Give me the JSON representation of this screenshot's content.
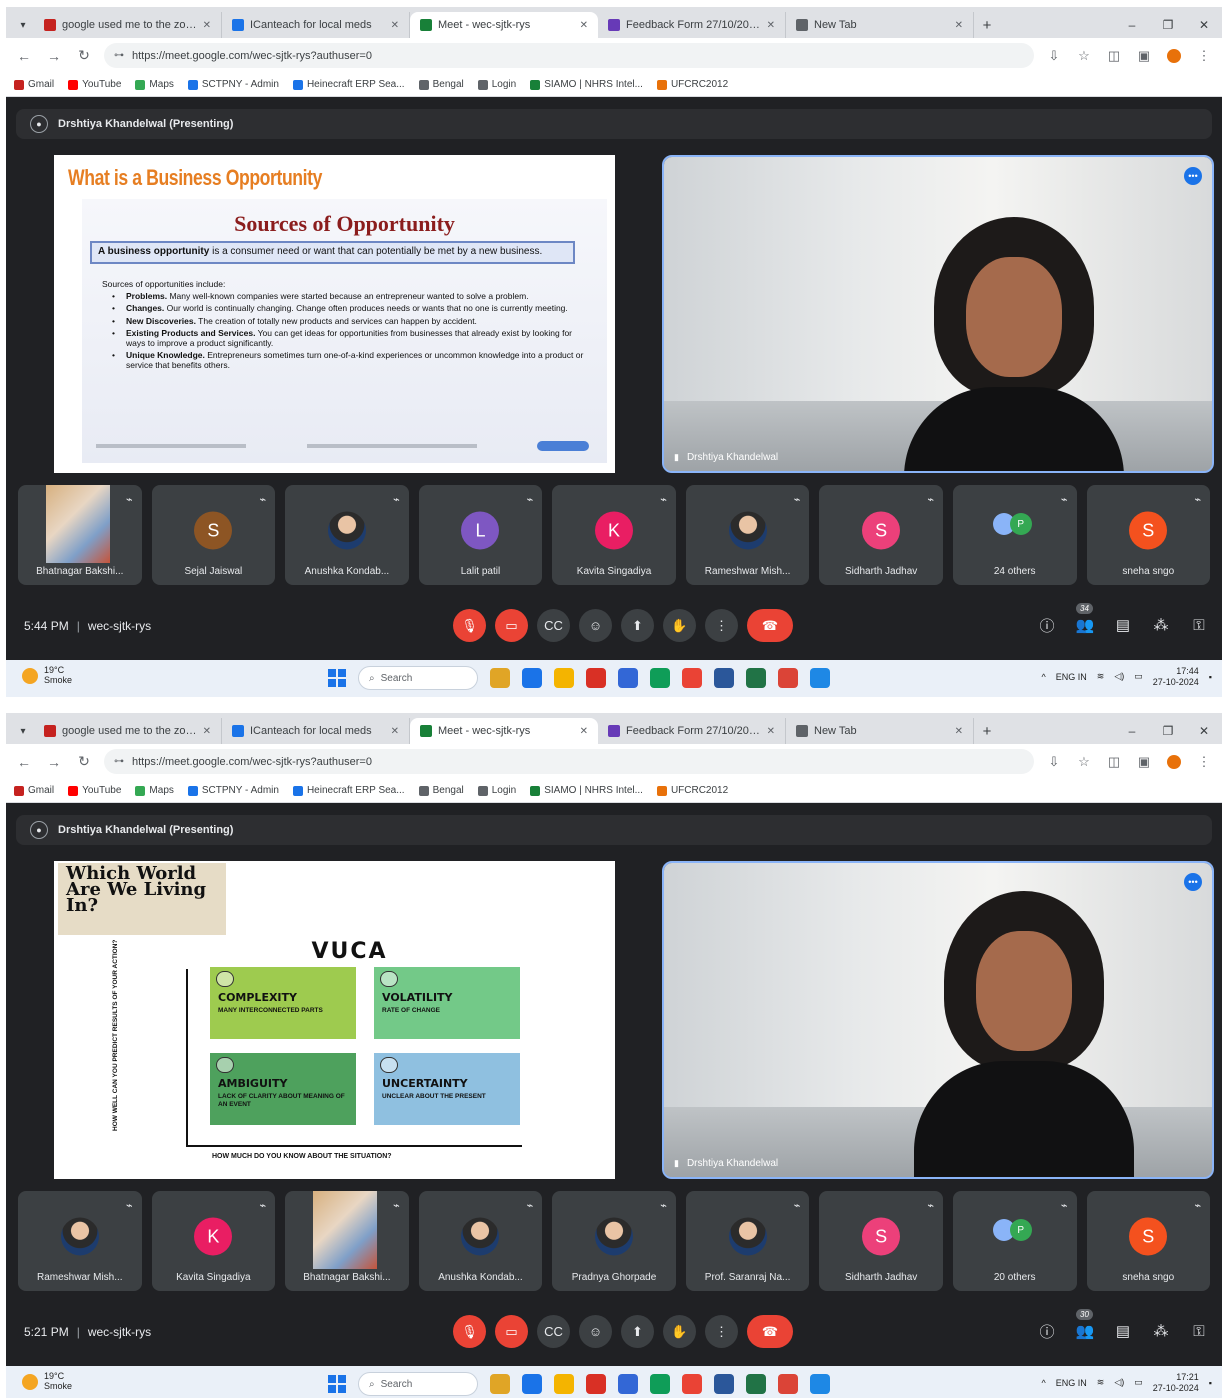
{
  "browser": {
    "tabs": [
      {
        "label": "google used me to the zoom",
        "color": "#c5221f"
      },
      {
        "label": "ICanteach for local meds",
        "color": "#1a73e8"
      },
      {
        "label": "Meet - wec-sjtk-rys",
        "color": "#188038"
      },
      {
        "label": "Feedback Form 27/10/2024",
        "color": "#673ab7"
      },
      {
        "label": "New Tab",
        "color": "#5f6368"
      }
    ],
    "url": "https://meet.google.com/wec-sjtk-rys?authuser=0",
    "bookmarks": [
      {
        "label": "Gmail",
        "color": "#c5221f"
      },
      {
        "label": "YouTube",
        "color": "#ff0000"
      },
      {
        "label": "Maps",
        "color": "#34a853"
      },
      {
        "label": "SCTPNY - Admin",
        "color": "#1a73e8"
      },
      {
        "label": "Heinecraft ERP Sea...",
        "color": "#1a73e8"
      },
      {
        "label": "Bengal",
        "color": "#5f6368"
      },
      {
        "label": "Login",
        "color": "#5f6368"
      },
      {
        "label": "SIAMO | NHRS Intel...",
        "color": "#188038"
      },
      {
        "label": "UFCRC2012",
        "color": "#e8710a"
      }
    ]
  },
  "screens": [
    {
      "presenter_bar": "Drshtiya Khandelwal (Presenting)",
      "slide": {
        "kind": "opportunity",
        "title": "What is a Business Opportunity",
        "heading": "Sources of Opportunity",
        "definition_bold": "A business opportunity",
        "definition_rest": " is a consumer need or want that can potentially be met by a new business.",
        "intro": "Sources of opportunities include:",
        "items": [
          {
            "term": "Problems.",
            "text": " Many well-known companies were started because an entrepreneur wanted to solve a problem."
          },
          {
            "term": "Changes.",
            "text": " Our world is continually changing. Change often produces needs or wants that no one is currently meeting."
          },
          {
            "term": "New Discoveries.",
            "text": " The creation of totally new products and services can happen by accident."
          },
          {
            "term": "Existing Products and Services.",
            "text": " You can get ideas for opportunities from businesses that already exist by looking for ways to improve a product significantly."
          },
          {
            "term": "Unique Knowledge.",
            "text": " Entrepreneurs sometimes turn one-of-a-kind experiences or uncommon knowledge into a product or service that benefits others."
          }
        ]
      },
      "speaker_name": "Drshtiya Khandelwal",
      "participants": [
        {
          "name": "Bhatnagar Bakshi...",
          "type": "photo",
          "initial": "",
          "color": ""
        },
        {
          "name": "Sejal Jaiswal",
          "type": "initial",
          "initial": "S",
          "color": "#8d5524"
        },
        {
          "name": "Anushka Kondab...",
          "type": "photo",
          "initial": "",
          "color": ""
        },
        {
          "name": "Lalit patil",
          "type": "initial",
          "initial": "L",
          "color": "#7e57c2"
        },
        {
          "name": "Kavita Singadiya",
          "type": "initial",
          "initial": "K",
          "color": "#e91e63"
        },
        {
          "name": "Rameshwar Mish...",
          "type": "photo",
          "initial": "",
          "color": ""
        },
        {
          "name": "Sidharth Jadhav",
          "type": "initial",
          "initial": "S",
          "color": "#ec407a"
        },
        {
          "name": "24 others",
          "type": "group",
          "initial": "P",
          "color": "#34a853"
        },
        {
          "name": "sneha sngo",
          "type": "initial",
          "initial": "S",
          "color": "#f4511e"
        }
      ],
      "time": "5:44 PM",
      "meeting_code": "wec-sjtk-rys",
      "people_count": "34",
      "clock_time": "17:44",
      "clock_date": "27-10-2024"
    },
    {
      "presenter_bar": "Drshtiya Khandelwal (Presenting)",
      "slide": {
        "kind": "vuca",
        "badge": "Which World Are We Living In?",
        "title": "VUCA",
        "y_axis_label": "HOW WELL CAN YOU PREDICT RESULTS OF YOUR ACTION?",
        "x_axis_label": "HOW MUCH DO YOU KNOW ABOUT THE SITUATION?",
        "quadrants": [
          {
            "heading": "COMPLEXITY",
            "sub": "Many interconnected parts",
            "color": "#9ecb4f"
          },
          {
            "heading": "VOLATILITY",
            "sub": "Rate of change",
            "color": "#73c988"
          },
          {
            "heading": "AMBIGUITY",
            "sub": "Lack of clarity about meaning of an event",
            "color": "#4ea15d"
          },
          {
            "heading": "UNCERTAINTY",
            "sub": "Unclear about the present",
            "color": "#8fc0e0"
          }
        ]
      },
      "speaker_name": "Drshtiya Khandelwal",
      "participants": [
        {
          "name": "Rameshwar Mish...",
          "type": "photo",
          "initial": "",
          "color": ""
        },
        {
          "name": "Kavita Singadiya",
          "type": "initial",
          "initial": "K",
          "color": "#e91e63"
        },
        {
          "name": "Bhatnagar Bakshi...",
          "type": "photo",
          "initial": "",
          "color": ""
        },
        {
          "name": "Anushka Kondab...",
          "type": "photo",
          "initial": "",
          "color": ""
        },
        {
          "name": "Pradnya Ghorpade",
          "type": "photo",
          "initial": "",
          "color": ""
        },
        {
          "name": "Prof. Saranraj Na...",
          "type": "photo",
          "initial": "",
          "color": ""
        },
        {
          "name": "Sidharth Jadhav",
          "type": "initial",
          "initial": "S",
          "color": "#ec407a"
        },
        {
          "name": "20 others",
          "type": "group",
          "initial": "P",
          "color": "#34a853"
        },
        {
          "name": "sneha sngo",
          "type": "initial",
          "initial": "S",
          "color": "#f4511e"
        }
      ],
      "time": "5:21 PM",
      "meeting_code": "wec-sjtk-rys",
      "people_count": "30",
      "clock_time": "17:21",
      "clock_date": "27-10-2024"
    }
  ],
  "taskbar": {
    "weather_temp": "19°C",
    "weather_desc": "Smoke",
    "search_placeholder": "Search",
    "apps": [
      "#e0a526",
      "#1a73e8",
      "#f4b400",
      "#d93025",
      "#3367d6",
      "#0f9d58",
      "#ea4335",
      "#2b579a",
      "#217346",
      "#db4437",
      "#1e88e5"
    ],
    "lang": "ENG IN"
  }
}
